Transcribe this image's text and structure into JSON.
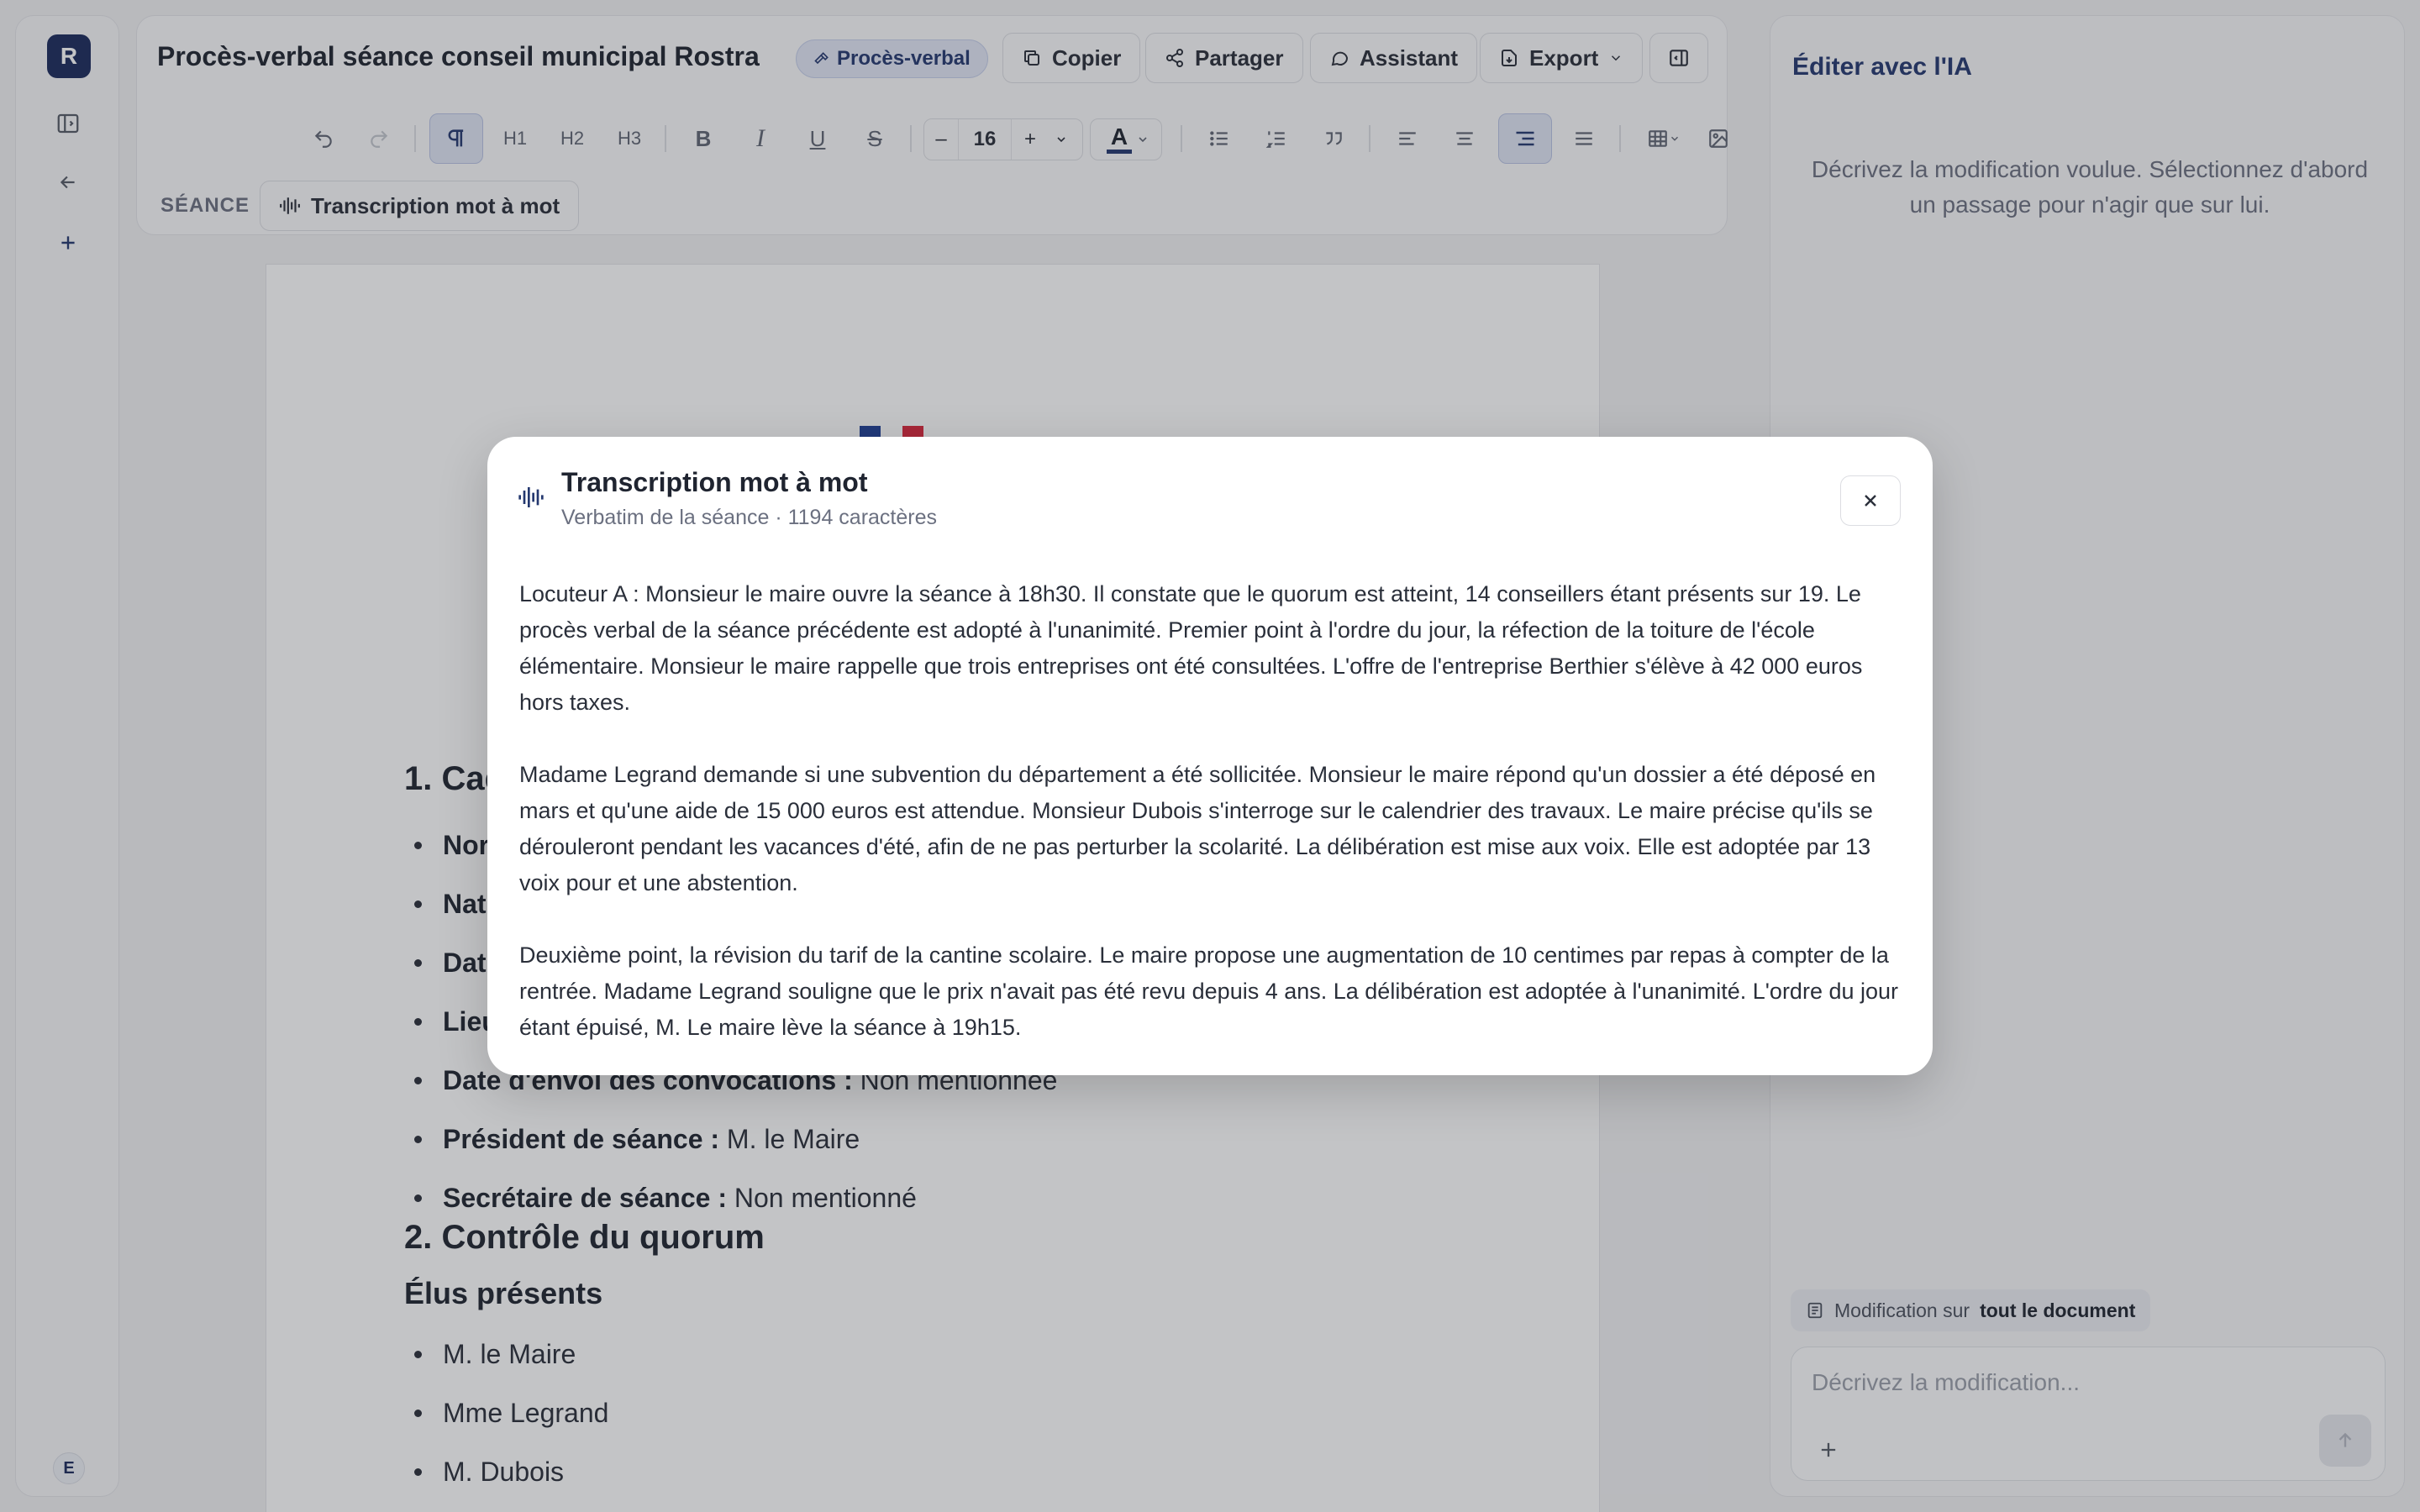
{
  "rail": {
    "logo": "R",
    "avatar": "E"
  },
  "header": {
    "title": "Procès-verbal séance conseil municipal Rostra",
    "badge": "Procès-verbal",
    "copy": "Copier",
    "share": "Partager",
    "assistant": "Assistant",
    "export": "Export"
  },
  "toolbar": {
    "h1": "H1",
    "h2": "H2",
    "h3": "H3",
    "bold": "B",
    "italic": "I",
    "underline": "U",
    "strike": "S",
    "font_size": "16",
    "text_color": "#24386f"
  },
  "seance": {
    "label": "SÉANCE",
    "chip": "Transcription mot à mot"
  },
  "document": {
    "section1_prefix": "1. Cad",
    "items1": [
      {
        "label": "Nor",
        "value": ""
      },
      {
        "label": "Nat",
        "value": ""
      },
      {
        "label": "Dat",
        "value": ""
      },
      {
        "label": "Lieu",
        "value": ""
      },
      {
        "label": "Date d'envoi des convocations :",
        "value": "Non mentionnée"
      },
      {
        "label": "Président de séance :",
        "value": "M. le Maire"
      },
      {
        "label": "Secrétaire de séance :",
        "value": "Non mentionné"
      }
    ],
    "section2": "2. Contrôle du quorum",
    "subsection": "Élus présents",
    "elus": [
      "M. le Maire",
      "Mme Legrand",
      "M. Dubois"
    ]
  },
  "ai_panel": {
    "title": "Éditer avec l'IA",
    "hint": "Décrivez la modification voulue. Sélectionnez d'abord un passage pour n'agir que sur lui.",
    "scope_prefix": "Modification sur",
    "scope_value": "tout le document",
    "input_placeholder": "Décrivez la modification..."
  },
  "modal": {
    "title": "Transcription mot à mot",
    "subtitle": "Verbatim de la séance · 1194 caractères",
    "paragraphs": [
      "Locuteur A : Monsieur le maire ouvre la séance à 18h30.  Il constate que le quorum est atteint, 14 conseillers étant présents sur 19.  Le procès verbal de la séance précédente est adopté à l'unanimité.  Premier point à l'ordre du jour, la réfection de la toiture de l'école élémentaire.  Monsieur le maire rappelle que trois entreprises ont été consultées.  L'offre de l'entreprise Berthier s'élève à 42 000 euros hors taxes.",
      "Madame Legrand demande si une subvention du département a été sollicitée.  Monsieur le maire répond qu'un dossier a été déposé en mars et qu'une aide de 15 000 euros est attendue.  Monsieur Dubois s'interroge sur le calendrier des travaux.  Le maire précise qu'ils se dérouleront pendant les vacances d'été, afin de ne pas perturber la scolarité.  La délibération est mise aux voix.  Elle est adoptée par 13 voix pour et une abstention.",
      "Deuxième point, la révision du tarif de la cantine scolaire.  Le maire propose une augmentation de 10 centimes par repas à compter de la rentrée.  Madame Legrand souligne que le prix n'avait pas été revu depuis 4 ans.  La délibération est adoptée à l'unanimité.  L'ordre du jour étant épuisé, M.  Le maire lève la séance à 19h15."
    ]
  }
}
